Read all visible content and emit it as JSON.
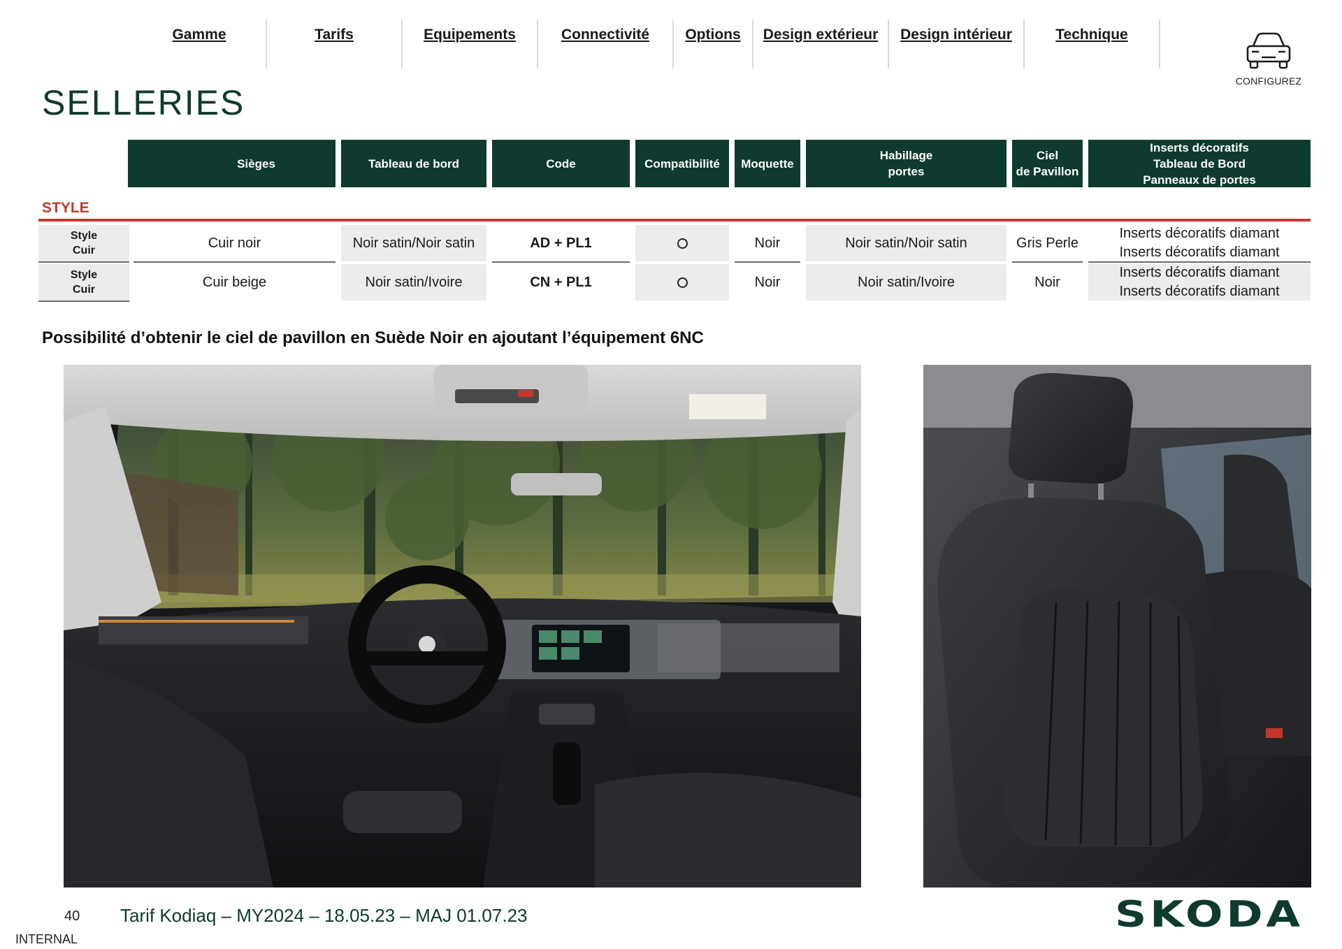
{
  "nav": {
    "items": [
      "Gamme",
      "Tarifs",
      "Equipements",
      "Connectivité",
      "Options",
      "Design extérieur",
      "Design intérieur",
      "Technique"
    ]
  },
  "configure": {
    "label": "CONFIGUREZ",
    "icon": "car-front-icon"
  },
  "page": {
    "title": "SELLERIES"
  },
  "table": {
    "headers": {
      "sieges": "Sièges",
      "tableau": "Tableau de bord",
      "code": "Code",
      "compat": "Compatibilité",
      "moquette": "Moquette",
      "habillage_1": "Habillage",
      "habillage_2": "portes",
      "ciel_1": "Ciel",
      "ciel_2": "de Pavillon",
      "inserts_1": "Inserts décoratifs",
      "inserts_2": "Tableau de Bord",
      "inserts_3": "Panneaux de portes"
    },
    "section": "STYLE",
    "rows": [
      {
        "label_1": "Style",
        "label_2": "Cuir",
        "sieges": "Cuir noir",
        "tableau": "Noir satin/Noir satin",
        "code": "AD + PL1",
        "compat": "○",
        "moquette": "Noir",
        "habillage": "Noir satin/Noir satin",
        "ciel": "Gris Perle",
        "inserts_1": "Inserts décoratifs diamant",
        "inserts_2": "Inserts décoratifs diamant"
      },
      {
        "label_1": "Style",
        "label_2": "Cuir",
        "sieges": "Cuir beige",
        "tableau": "Noir satin/Ivoire",
        "code": "CN + PL1",
        "compat": "○",
        "moquette": "Noir",
        "habillage": "Noir satin/Ivoire",
        "ciel": "Noir",
        "inserts_1": "Inserts décoratifs diamant",
        "inserts_2": "Inserts décoratifs diamant"
      }
    ]
  },
  "note": "Possibilité d’obtenir le ciel de pavillon en Suède Noir en ajoutant l’équipement 6NC",
  "footer": {
    "page_number": "40",
    "text": "Tarif Kodiaq – MY2024 – 18.05.23 – MAJ 01.07.23",
    "classification": "INTERNAL",
    "brand": "SKODA"
  },
  "colors": {
    "primary": "#0e3a2f",
    "accent": "#c63b32",
    "cell_shade": "#ececec"
  }
}
